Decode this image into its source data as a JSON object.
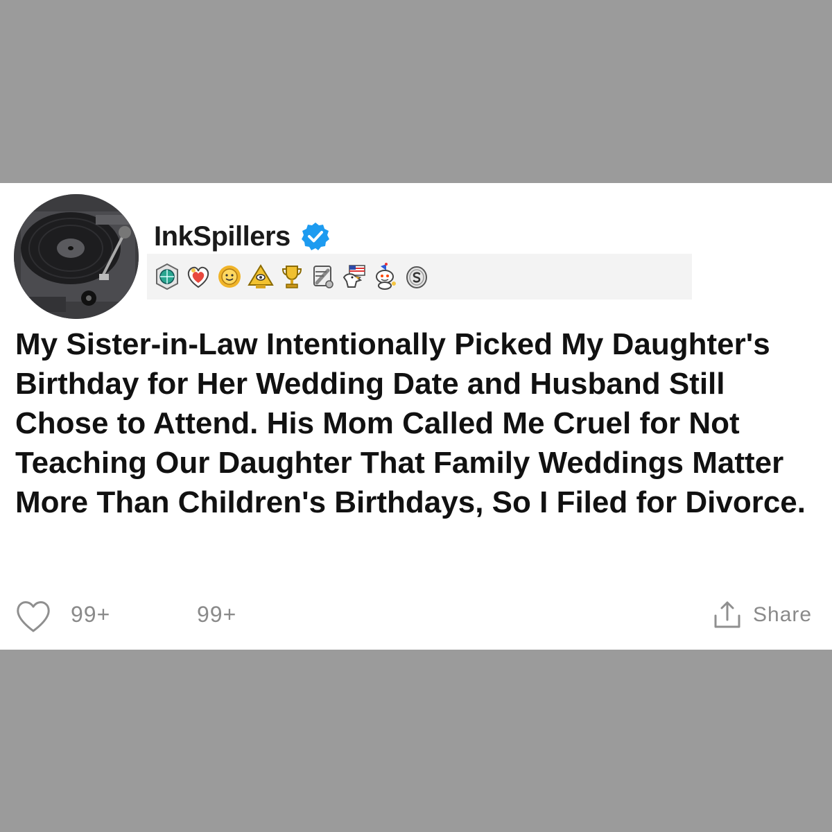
{
  "post": {
    "author": "InkSpillers",
    "verified": true,
    "title": "My Sister-in-Law Intentionally Picked My Daughter's Birthday for Her Wedding Date and Husband Still Chose to Attend. His Mom Called Me Cruel for Not Teaching Our Daughter That Family Weddings Matter More Than Children's Birthdays, So I Filed for Divorce.",
    "awards": [
      "globe-award-icon",
      "heart-hug-award-icon",
      "sun-award-icon",
      "pyramid-award-icon",
      "trophy-award-icon",
      "wrench-award-icon",
      "eagle-flag-award-icon",
      "snoo-party-award-icon",
      "silver-coin-award-icon"
    ],
    "likes": "99+",
    "comments": "99+",
    "share_label": "Share"
  },
  "colors": {
    "background_band": "#9b9b9b",
    "card": "#ffffff",
    "verified_blue": "#1d9bf0",
    "muted_text": "#8a8a8a",
    "title_text": "#111111"
  }
}
